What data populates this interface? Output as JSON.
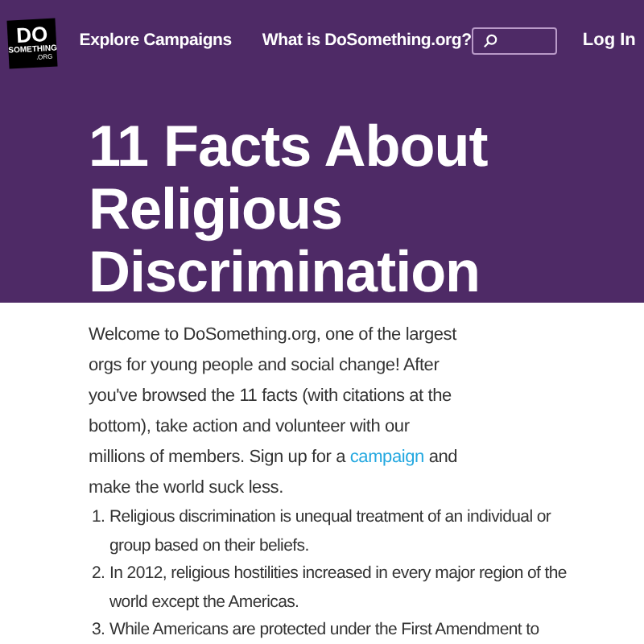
{
  "header": {
    "logo": {
      "top": "DO",
      "middle": "SOMETHING",
      "bottom": ".ORG"
    },
    "nav": [
      {
        "label": "Explore Campaigns"
      },
      {
        "label": "What is DoSomething.org?"
      }
    ],
    "login": "Log In"
  },
  "title": "11 Facts About Religious Discrimination",
  "intro": {
    "before": "Welcome to DoSomething.org, one of the largest orgs for young people and social change! After you've browsed the 11 facts (with citations at the bottom), take action and volunteer with our millions of members. Sign up for a ",
    "link": "campaign",
    "after": " and make the world suck less."
  },
  "facts": [
    {
      "number": "1.",
      "text": "Religious discrimination is unequal treatment of an individual or group based on their beliefs."
    },
    {
      "number": "2.",
      "text": "In 2012, religious hostilities increased in every major region of the world except the Americas."
    },
    {
      "number": "3.",
      "text": "While Americans are protected under the First Amendment to"
    }
  ]
}
